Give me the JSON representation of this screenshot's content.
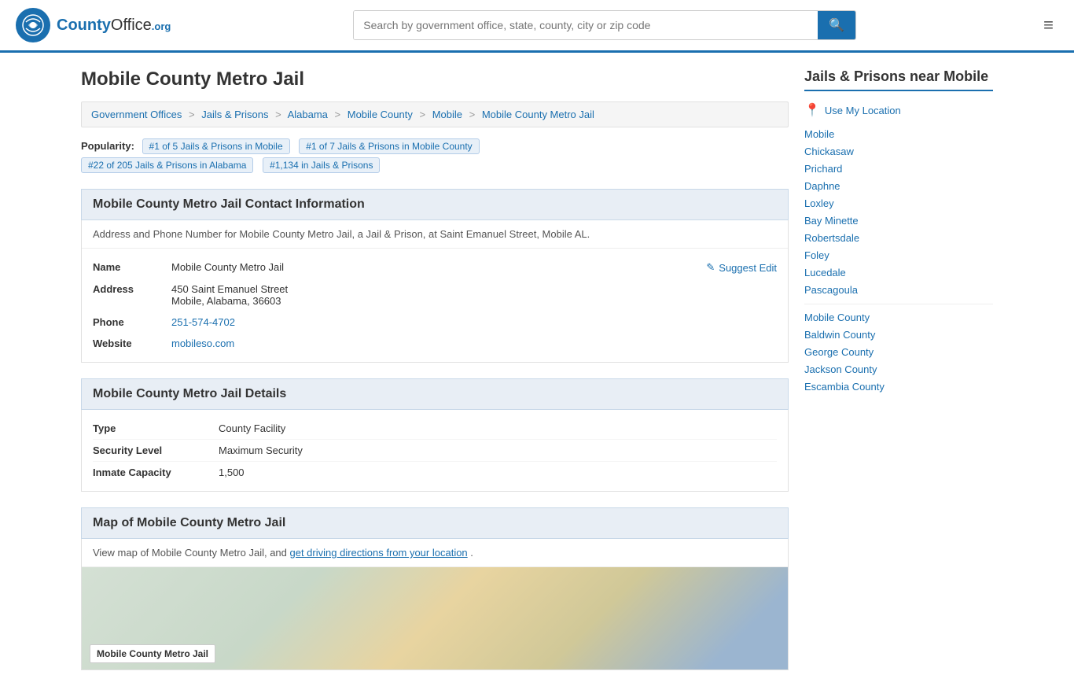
{
  "header": {
    "logo_text": "County",
    "logo_org": "Office",
    "logo_domain": ".org",
    "search_placeholder": "Search by government office, state, county, city or zip code",
    "search_btn_icon": "🔍"
  },
  "page": {
    "title": "Mobile County Metro Jail"
  },
  "breadcrumb": {
    "items": [
      {
        "label": "Government Offices",
        "href": "#"
      },
      {
        "label": "Jails & Prisons",
        "href": "#"
      },
      {
        "label": "Alabama",
        "href": "#"
      },
      {
        "label": "Mobile County",
        "href": "#"
      },
      {
        "label": "Mobile",
        "href": "#"
      },
      {
        "label": "Mobile County Metro Jail",
        "href": "#"
      }
    ]
  },
  "popularity": {
    "label": "Popularity:",
    "badge1": "#1 of 5 Jails & Prisons in Mobile",
    "badge2": "#1 of 7 Jails & Prisons in Mobile County",
    "badge3": "#22 of 205 Jails & Prisons in Alabama",
    "badge4": "#1,134 in Jails & Prisons"
  },
  "contact": {
    "section_title": "Mobile County Metro Jail Contact Information",
    "description": "Address and Phone Number for Mobile County Metro Jail, a Jail & Prison, at Saint Emanuel Street, Mobile AL.",
    "name_label": "Name",
    "name_value": "Mobile County Metro Jail",
    "address_label": "Address",
    "address_line1": "450 Saint Emanuel Street",
    "address_line2": "Mobile, Alabama, 36603",
    "phone_label": "Phone",
    "phone_value": "251-574-4702",
    "website_label": "Website",
    "website_value": "mobileso.com",
    "suggest_edit": "Suggest Edit"
  },
  "details": {
    "section_title": "Mobile County Metro Jail Details",
    "type_label": "Type",
    "type_value": "County Facility",
    "security_label": "Security Level",
    "security_value": "Maximum Security",
    "capacity_label": "Inmate Capacity",
    "capacity_value": "1,500"
  },
  "map": {
    "section_title": "Map of Mobile County Metro Jail",
    "description": "View map of Mobile County Metro Jail, and ",
    "link_text": "get driving directions from your location",
    "description_end": ".",
    "map_label": "Mobile County Metro Jail"
  },
  "sidebar": {
    "title": "Jails & Prisons near Mobile",
    "use_my_location": "Use My Location",
    "cities": [
      {
        "label": "Mobile",
        "href": "#"
      },
      {
        "label": "Chickasaw",
        "href": "#"
      },
      {
        "label": "Prichard",
        "href": "#"
      },
      {
        "label": "Daphne",
        "href": "#"
      },
      {
        "label": "Loxley",
        "href": "#"
      },
      {
        "label": "Bay Minette",
        "href": "#"
      },
      {
        "label": "Robertsdale",
        "href": "#"
      },
      {
        "label": "Foley",
        "href": "#"
      },
      {
        "label": "Lucedale",
        "href": "#"
      },
      {
        "label": "Pascagoula",
        "href": "#"
      }
    ],
    "counties": [
      {
        "label": "Mobile County",
        "href": "#"
      },
      {
        "label": "Baldwin County",
        "href": "#"
      },
      {
        "label": "George County",
        "href": "#"
      },
      {
        "label": "Jackson County",
        "href": "#"
      },
      {
        "label": "Escambia County",
        "href": "#"
      }
    ]
  }
}
